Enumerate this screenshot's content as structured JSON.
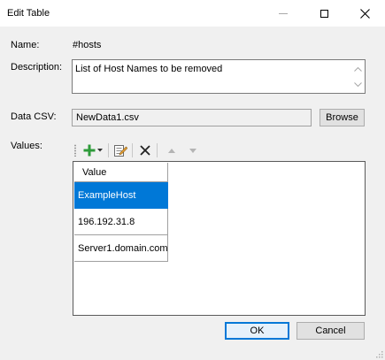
{
  "window": {
    "title": "Edit Table"
  },
  "form": {
    "name_label": "Name:",
    "name_value": "#hosts",
    "description_label": "Description:",
    "description_value": "List of Host Names to be removed",
    "csv_label": "Data CSV:",
    "csv_value": "NewData1.csv",
    "browse_label": "Browse",
    "values_label": "Values:"
  },
  "grid": {
    "column_header": "Value",
    "rows": [
      "ExampleHost",
      "196.192.31.8",
      "Server1.domain.com"
    ],
    "selected_row": 0
  },
  "buttons": {
    "ok": "OK",
    "cancel": "Cancel"
  },
  "icons": {
    "add": "green-plus-icon",
    "dropdown": "chevron-down-icon",
    "edit": "edit-pencil-icon",
    "delete": "delete-x-icon",
    "move_up": "arrow-up-icon",
    "move_down": "arrow-down-icon"
  },
  "colors": {
    "selection": "#0078d7",
    "add_icon": "#2e9b3a"
  }
}
